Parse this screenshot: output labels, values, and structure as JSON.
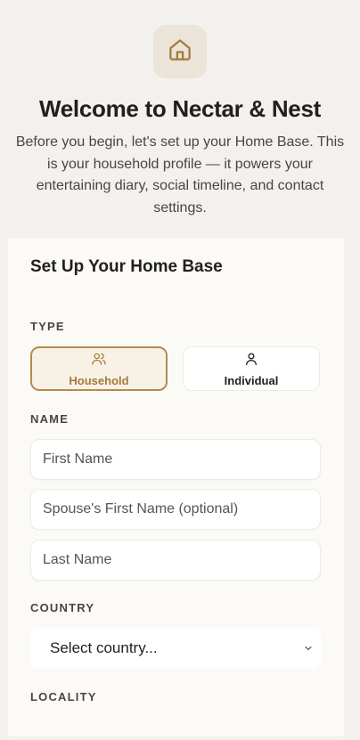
{
  "header": {
    "logo_icon": "house-icon",
    "title": "Welcome to Nectar & Nest",
    "intro": "Before you begin, let's set up your Home Base. This is your household profile — it powers your entertaining diary, social timeline, and contact settings."
  },
  "form": {
    "title": "Set Up Your Home Base",
    "type": {
      "label": "TYPE",
      "options": [
        {
          "label": "Household",
          "icon": "users-icon",
          "selected": true
        },
        {
          "label": "Individual",
          "icon": "user-icon",
          "selected": false
        }
      ]
    },
    "name": {
      "label": "NAME",
      "first_name_placeholder": "First Name",
      "spouse_placeholder": "Spouse's First Name (optional)",
      "last_name_placeholder": "Last Name"
    },
    "country": {
      "label": "COUNTRY",
      "selected": "Select country..."
    },
    "locality": {
      "label": "LOCALITY"
    }
  },
  "colors": {
    "accent": "#b38c4e",
    "background": "#f2f1ee",
    "card": "#fbfaf7"
  }
}
